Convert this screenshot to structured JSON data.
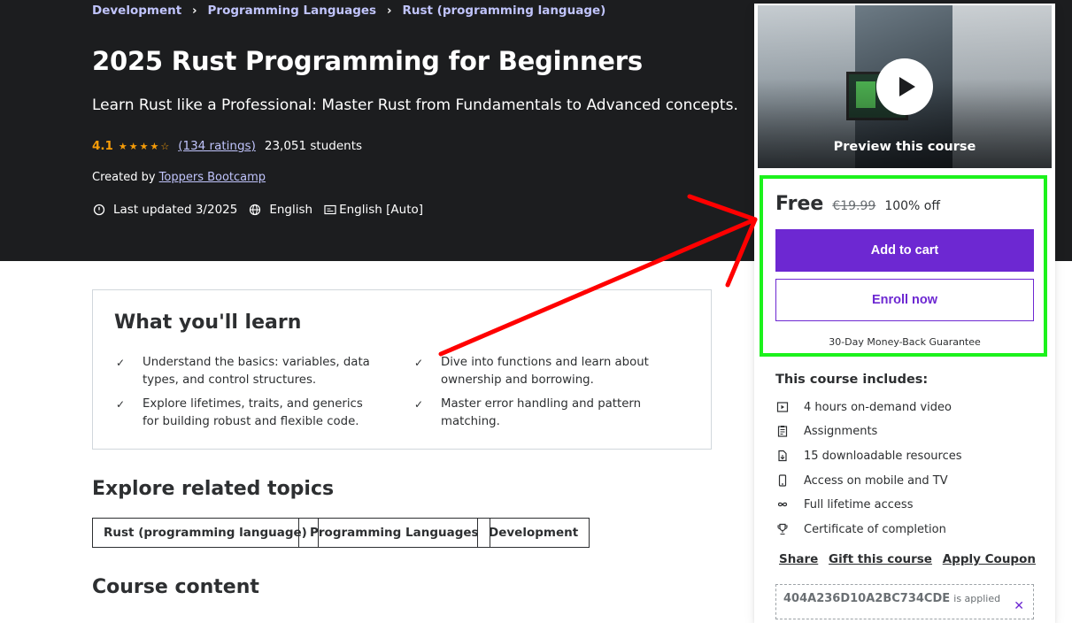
{
  "breadcrumb": {
    "items": [
      "Development",
      "Programming Languages",
      "Rust (programming language)"
    ],
    "separator": "›"
  },
  "course": {
    "title": "2025 Rust Programming for Beginners",
    "subtitle": "Learn Rust like a Professional: Master Rust from Fundamentals to Advanced concepts.",
    "rating": "4.1",
    "rating_value": 4.1,
    "ratings_count": "(134 ratings)",
    "students": "23,051 students",
    "created_prefix": "Created by",
    "author": "Toppers Bootcamp",
    "last_updated": "Last updated 3/2025",
    "language": "English",
    "captions": "English [Auto]"
  },
  "learn": {
    "title": "What you'll learn",
    "items": [
      "Understand the basics: variables, data types, and control structures.",
      "Dive into functions and learn about ownership and borrowing.",
      "Explore lifetimes, traits, and generics for building robust and flexible code.",
      "Master error handling and pattern matching."
    ]
  },
  "related": {
    "title": "Explore related topics",
    "topics": [
      "Rust (programming language)",
      "Programming Languages",
      "Development"
    ]
  },
  "content": {
    "title": "Course content"
  },
  "sidebar": {
    "preview_label": "Preview this course",
    "price": "Free",
    "old_price": "€19.99",
    "discount": "100% off",
    "add_to_cart": "Add to cart",
    "enroll_now": "Enroll now",
    "guarantee": "30-Day Money-Back Guarantee",
    "includes_title": "This course includes:",
    "includes": [
      {
        "icon": "video-icon",
        "label": "4 hours on-demand video"
      },
      {
        "icon": "assignment-icon",
        "label": "Assignments"
      },
      {
        "icon": "download-file-icon",
        "label": "15 downloadable resources"
      },
      {
        "icon": "mobile-icon",
        "label": "Access on mobile and TV"
      },
      {
        "icon": "infinity-icon",
        "label": "Full lifetime access"
      },
      {
        "icon": "trophy-icon",
        "label": "Certificate of completion"
      }
    ],
    "share": "Share",
    "gift": "Gift this course",
    "coupon": "Apply Coupon",
    "coupon_code": "404A236D10A2BC734CDE",
    "coupon_applied": "is applied"
  },
  "colors": {
    "hero_bg": "#1c1d1f",
    "accent": "#6d28d2",
    "star": "#f69c08",
    "link": "#c0c4fc",
    "highlight": "#1cf21c",
    "arrow": "#ff0000"
  }
}
